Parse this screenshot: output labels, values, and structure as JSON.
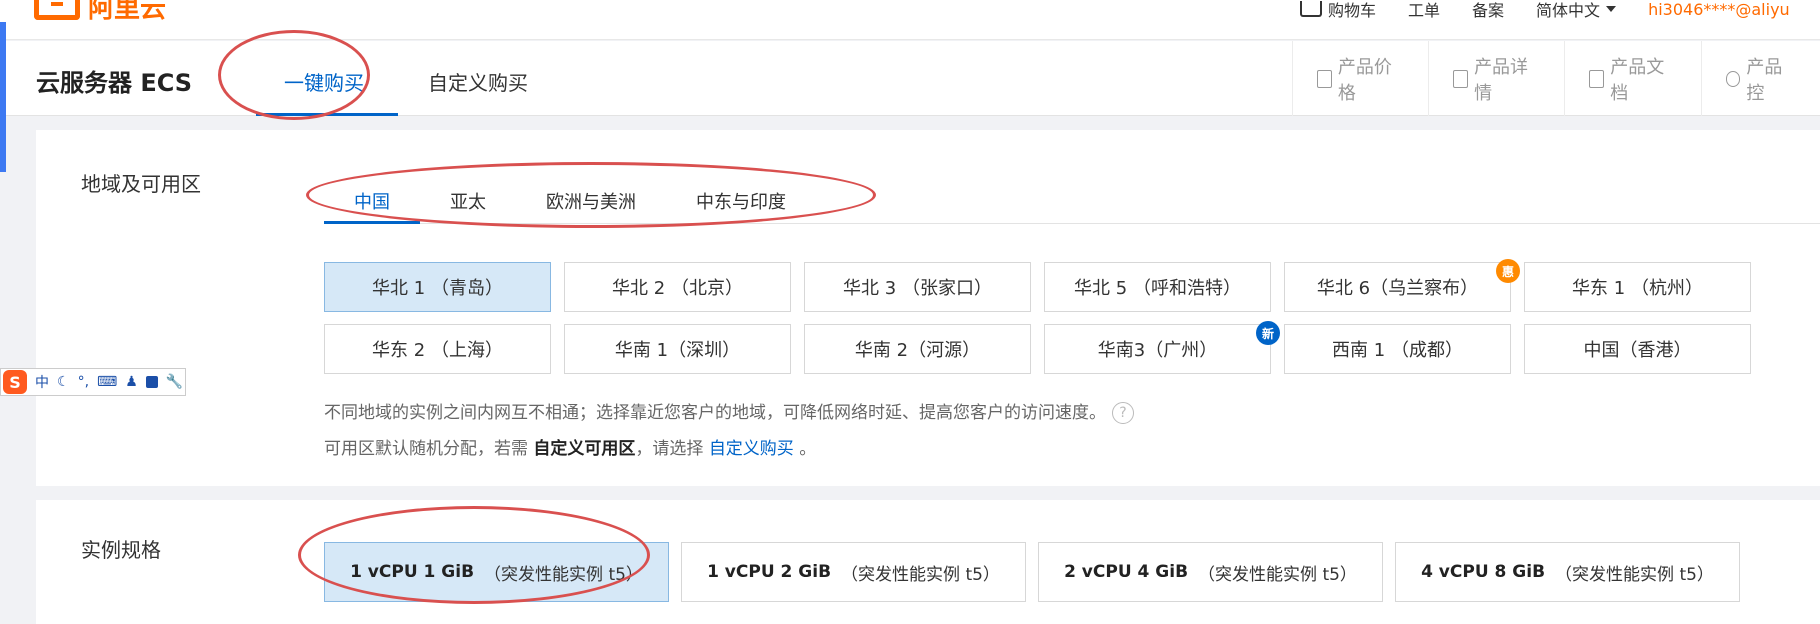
{
  "topnav": {
    "logo_text": "阿里云",
    "cart": "购物车",
    "ticket": "工单",
    "record": "备案",
    "language": "简体中文",
    "user": "hi3046****@aliyu"
  },
  "product": {
    "title": "云服务器 ECS",
    "tabs": [
      {
        "label": "一键购买",
        "active": true
      },
      {
        "label": "自定义购买",
        "active": false
      }
    ],
    "links": [
      "产品价格",
      "产品详情",
      "产品文档",
      "产品控"
    ]
  },
  "region": {
    "label": "地域及可用区",
    "tabs": [
      {
        "label": "中国",
        "active": true
      },
      {
        "label": "亚太",
        "active": false
      },
      {
        "label": "欧洲与美洲",
        "active": false
      },
      {
        "label": "中东与印度",
        "active": false
      }
    ],
    "zones": [
      {
        "label": "华北 1 （青岛）",
        "selected": true
      },
      {
        "label": "华北 2 （北京）"
      },
      {
        "label": "华北 3 （张家口）"
      },
      {
        "label": "华北 5 （呼和浩特）"
      },
      {
        "label": "华北 6（乌兰察布）",
        "badge": "惠"
      },
      {
        "label": "华东 1 （杭州）"
      },
      {
        "label": "华东 2 （上海）"
      },
      {
        "label": "华南 1（深圳）"
      },
      {
        "label": "华南 2（河源）"
      },
      {
        "label": "华南3（广州）",
        "badge": "新"
      },
      {
        "label": "西南 1 （成都）"
      },
      {
        "label": "中国（香港）"
      }
    ],
    "note1": "不同地域的实例之间内网互不相通；选择靠近您客户的地域，可降低网络时延、提高您客户的访问速度。",
    "help": "?",
    "note2_prefix": "可用区默认随机分配，若需",
    "note2_bold": "自定义可用区",
    "note2_mid": "，请选择",
    "note2_link": "自定义购买",
    "note2_suffix": "。"
  },
  "spec": {
    "label": "实例规格",
    "items": [
      {
        "main": "1 vCPU 1 GiB",
        "sub": "（突发性能实例 t5）",
        "selected": true
      },
      {
        "main": "1 vCPU 2 GiB",
        "sub": "（突发性能实例 t5）"
      },
      {
        "main": "2 vCPU 4 GiB",
        "sub": "（突发性能实例 t5）"
      },
      {
        "main": "4 vCPU 8 GiB",
        "sub": "（突发性能实例 t5）"
      }
    ]
  },
  "ime": {
    "logo": "S",
    "mode": "中"
  },
  "colors": {
    "accent": "#0064c8",
    "brand": "#ff6a00",
    "annotation": "#d9504f"
  }
}
